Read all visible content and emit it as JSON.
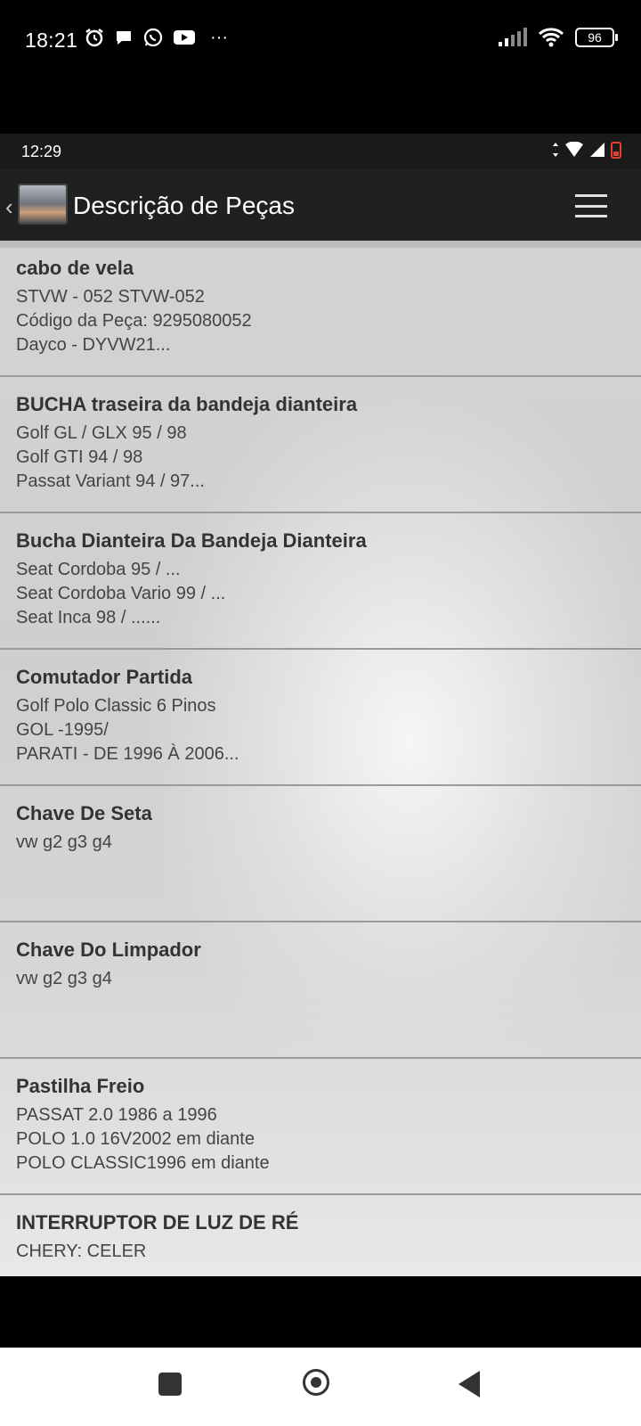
{
  "status_bar": {
    "time": "18:21",
    "battery": "96",
    "more": "···",
    "left_icons": [
      "alarm-icon",
      "chat-icon",
      "whatsapp-icon",
      "youtube-icon"
    ],
    "right_icons": [
      "signal-icon",
      "wifi-icon",
      "battery-icon"
    ]
  },
  "inner_status": {
    "time": "12:29",
    "icons": [
      "data-arrows-icon",
      "wifi-icon",
      "signal-icon",
      "battery-low-icon"
    ]
  },
  "appbar": {
    "title": "Descrição de Peças",
    "back_icon": "back-arrow-icon",
    "menu_icon": "hamburger-menu-icon",
    "logo": "car-logo-icon"
  },
  "items": [
    {
      "name": "cabo de vela",
      "lines": [
        "STVW - 052 STVW-052",
        "Código da Peça: 9295080052",
        "Dayco - DYVW21..."
      ]
    },
    {
      "name": "BUCHA traseira da bandeja dianteira",
      "lines": [
        "Golf GL / GLX 95 / 98",
        "Golf GTI 94 / 98",
        "Passat Variant 94 / 97..."
      ]
    },
    {
      "name": "Bucha Dianteira Da Bandeja Dianteira",
      "lines": [
        "Seat Cordoba 95 / ...",
        "Seat Cordoba Vario 99 / ...",
        "Seat Inca 98 / ......"
      ]
    },
    {
      "name": "Comutador Partida",
      "lines": [
        "Golf Polo Classic 6 Pinos",
        "GOL -1995/",
        "PARATI - DE 1996 À 2006..."
      ]
    },
    {
      "name": "Chave De Seta",
      "lines": [
        "vw g2 g3 g4",
        "",
        ""
      ]
    },
    {
      "name": "Chave Do Limpador",
      "lines": [
        "vw g2 g3 g4",
        "",
        ""
      ]
    },
    {
      "name": "Pastilha Freio",
      "lines": [
        "PASSAT 2.0  1986 a 1996",
        "POLO 1.0 16V2002 em diante",
        "POLO CLASSIC1996 em diante"
      ]
    },
    {
      "name": "INTERRUPTOR DE LUZ DE RÉ",
      "lines": [
        "CHERY: CELER",
        "",
        ""
      ]
    }
  ],
  "nav": {
    "recents_icon": "square-recents-icon",
    "home_icon": "home-circle-icon",
    "back_icon": "triangle-back-icon"
  }
}
